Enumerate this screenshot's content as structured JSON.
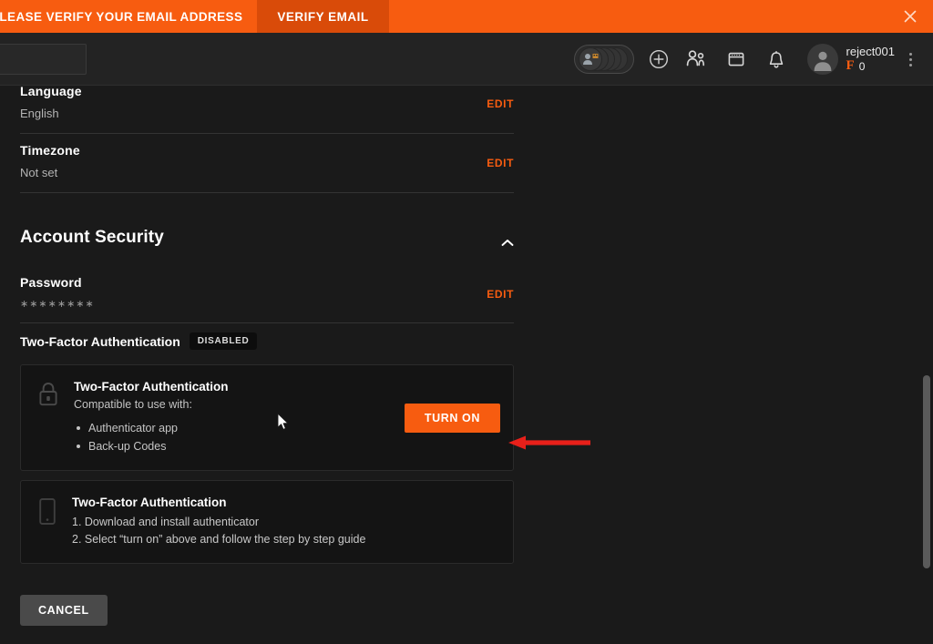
{
  "banner": {
    "message": "PLEASE VERIFY YOUR EMAIL ADDRESS",
    "cta_label": "VERIFY EMAIL",
    "close_icon": "close-icon",
    "bg_color": "#f75c10",
    "cta_bg_color": "#d94b09"
  },
  "topbar": {
    "search_placeholder": "",
    "search_value": "",
    "friends_pill_icon": "friends-stack-icon",
    "add_icon": "plus-circle-icon",
    "people_icon": "people-icon",
    "inbox_icon": "inbox-icon",
    "notifications_icon": "bell-icon",
    "avatar_icon": "avatar-icon",
    "username": "reject001",
    "currency_symbol": "F",
    "currency_amount": "0",
    "currency_color": "#f75c10",
    "more_icon": "kebab-menu-icon"
  },
  "settings": {
    "fields": [
      {
        "label": "Language",
        "value": "English",
        "action": "EDIT"
      },
      {
        "label": "Timezone",
        "value": "Not set",
        "action": "EDIT"
      }
    ],
    "security_section": {
      "title": "Account Security",
      "collapse_icon": "chevron-up-icon",
      "password": {
        "label": "Password",
        "value": "∗∗∗∗∗∗∗∗",
        "action": "EDIT"
      },
      "two_factor": {
        "label": "Two-Factor Authentication",
        "status_badge": "DISABLED"
      },
      "cards": [
        {
          "icon": "lock-icon",
          "title": "Two-Factor Authentication",
          "subtitle": "Compatible to use with:",
          "items": [
            "Authenticator app",
            "Back-up Codes"
          ],
          "button_label": "TURN ON",
          "button_color": "#f75c10"
        },
        {
          "icon": "mobile-phone-icon",
          "title": "Two-Factor Authentication",
          "steps": [
            "1. Download and install authenticator",
            "2. Select “turn on” above and follow the step by step guide"
          ]
        }
      ]
    },
    "cancel_label": "CANCEL"
  },
  "annotation": {
    "arrow_icon": "red-left-arrow-annotation",
    "arrow_color": "#e8201a"
  },
  "cursor": {
    "icon": "mouse-pointer-icon"
  },
  "scrollbar": {
    "thumb_color": "#5a5a5a"
  }
}
